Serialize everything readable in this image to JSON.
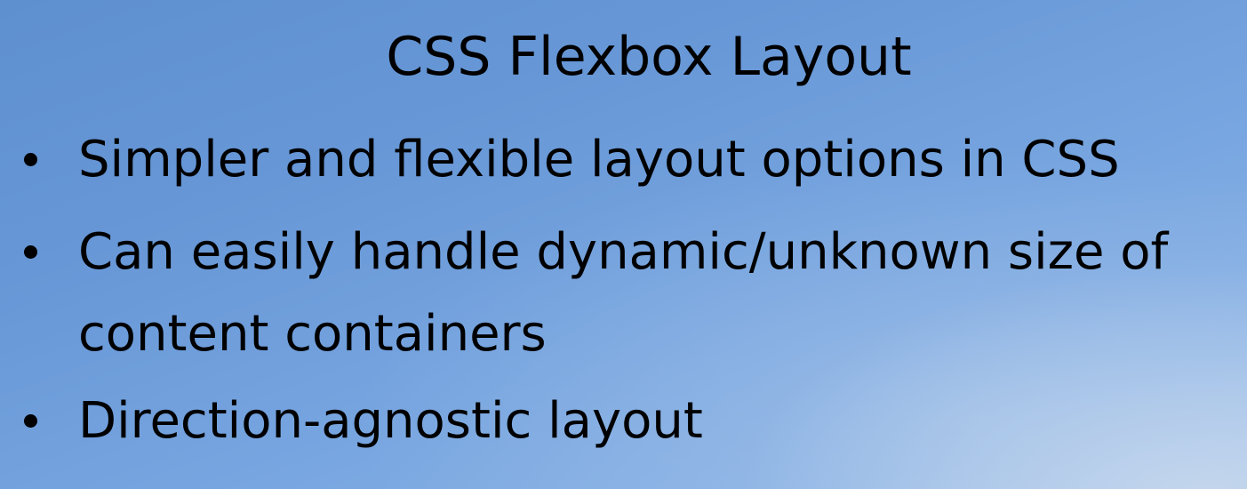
{
  "slide": {
    "title": "CSS Flexbox Layout",
    "bullets": [
      {
        "text": "Simpler and flexible layout options in CSS"
      },
      {
        "line1": "Can easily handle dynamic/unknown size of",
        "line2": "content containers"
      },
      {
        "text": "Direction-agnostic layout"
      }
    ]
  }
}
